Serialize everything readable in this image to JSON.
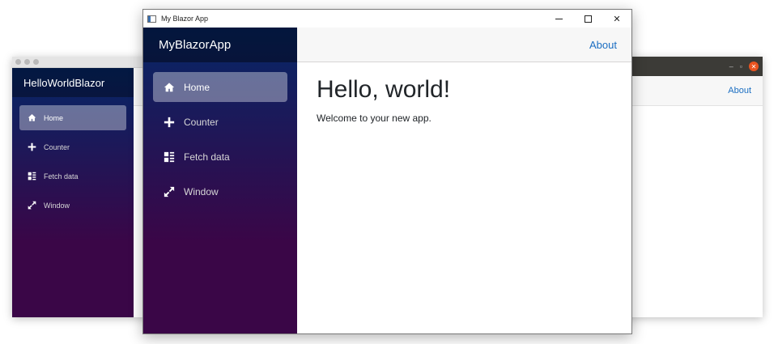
{
  "back_left_window": {
    "brand": "HelloWorldBlazor",
    "nav": [
      {
        "label": "Home",
        "icon": "home-icon",
        "active": true
      },
      {
        "label": "Counter",
        "icon": "plus-icon",
        "active": false
      },
      {
        "label": "Fetch data",
        "icon": "list-icon",
        "active": false
      },
      {
        "label": "Window",
        "icon": "expand-icon",
        "active": false
      }
    ]
  },
  "back_right_window": {
    "about": "About"
  },
  "front_window": {
    "title": "My Blazor App",
    "brand": "MyBlazorApp",
    "about": "About",
    "nav": [
      {
        "label": "Home",
        "icon": "home-icon",
        "active": true
      },
      {
        "label": "Counter",
        "icon": "plus-icon",
        "active": false
      },
      {
        "label": "Fetch data",
        "icon": "list-icon",
        "active": false
      },
      {
        "label": "Window",
        "icon": "expand-icon",
        "active": false
      }
    ],
    "heading": "Hello, world!",
    "body_text": "Welcome to your new app."
  },
  "colors": {
    "sidebar_top": "#052767",
    "sidebar_bottom": "#3a0647",
    "link": "#1b6ec2",
    "ubuntu_close": "#e95420"
  }
}
